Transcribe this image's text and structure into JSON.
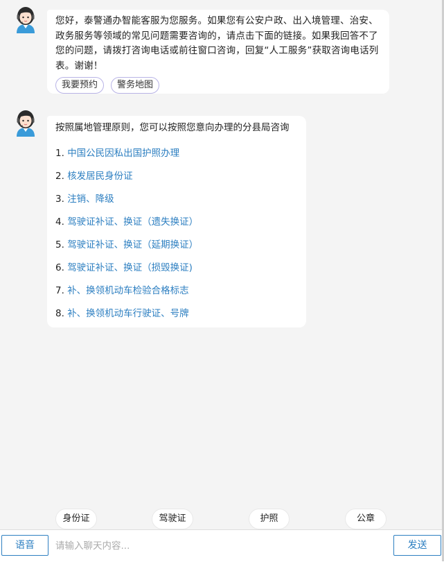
{
  "messages": [
    {
      "text": "您好，泰警通办智能客服为您服务。如果您有公安户政、出入境管理、治安、政务服务等领域的常见问题需要咨询的，请点击下面的链接。如果我回答不了您的问题，请拨打咨询电话或前往窗口咨询，回复“人工服务”获取咨询电话列表。谢谢！",
      "chips": [
        "我要预约",
        "警务地图"
      ]
    },
    {
      "intro": "按照属地管理原则，您可以按照您意向办理的分县局咨询",
      "options": [
        {
          "num": "1.",
          "label": "中国公民因私出国护照办理"
        },
        {
          "num": "2.",
          "label": "核发居民身份证"
        },
        {
          "num": "3.",
          "label": "注销、降级"
        },
        {
          "num": "4.",
          "label": "驾驶证补证、换证（遗失换证）"
        },
        {
          "num": "5.",
          "label": "驾驶证补证、换证（延期换证）"
        },
        {
          "num": "6.",
          "label": "驾驶证补证、换证（损毁换证)"
        },
        {
          "num": "7.",
          "label": "补、换领机动车检验合格标志"
        },
        {
          "num": "8.",
          "label": "补、换领机动车行驶证、号牌"
        }
      ]
    }
  ],
  "quick_replies": [
    "身份证",
    "驾驶证",
    "护照",
    "公章"
  ],
  "input": {
    "placeholder": "请输入聊天内容..."
  },
  "buttons": {
    "voice": "语音",
    "send": "发送"
  },
  "colors": {
    "link": "#2d7fc1",
    "background": "#f4f4f4",
    "chip_border": "#b8b3e6"
  },
  "icons": {
    "avatar": "customer-service-avatar-icon"
  }
}
